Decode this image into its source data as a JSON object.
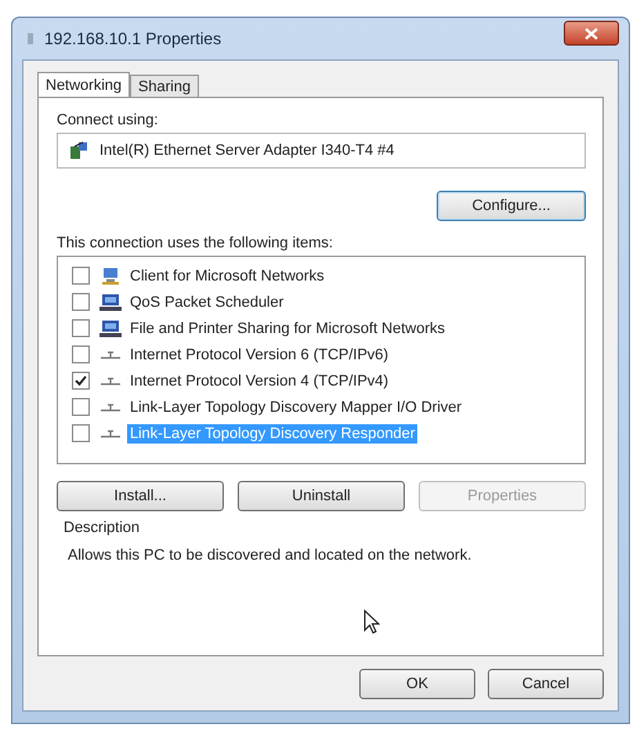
{
  "window": {
    "title": "192.168.10.1 Properties"
  },
  "tabs": [
    {
      "label": "Networking",
      "selected": true
    },
    {
      "label": "Sharing",
      "selected": false
    }
  ],
  "connect_using": {
    "label": "Connect using:",
    "adapter": "Intel(R) Ethernet Server Adapter I340-T4 #4",
    "configure_button": "Configure..."
  },
  "items_label": "This connection uses the following items:",
  "items": [
    {
      "label": "Client for Microsoft Networks",
      "kind": "client",
      "checked": false,
      "selected": false
    },
    {
      "label": "QoS Packet Scheduler",
      "kind": "service",
      "checked": false,
      "selected": false
    },
    {
      "label": "File and Printer Sharing for Microsoft Networks",
      "kind": "service",
      "checked": false,
      "selected": false
    },
    {
      "label": "Internet Protocol Version 6 (TCP/IPv6)",
      "kind": "protocol",
      "checked": false,
      "selected": false
    },
    {
      "label": "Internet Protocol Version 4 (TCP/IPv4)",
      "kind": "protocol",
      "checked": true,
      "selected": false
    },
    {
      "label": "Link-Layer Topology Discovery Mapper I/O Driver",
      "kind": "protocol",
      "checked": false,
      "selected": false
    },
    {
      "label": "Link-Layer Topology Discovery Responder",
      "kind": "protocol",
      "checked": false,
      "selected": true
    }
  ],
  "item_buttons": [
    {
      "label": "Install...",
      "disabled": false
    },
    {
      "label": "Uninstall",
      "disabled": false
    },
    {
      "label": "Properties",
      "disabled": true
    }
  ],
  "description": {
    "label": "Description",
    "text": "Allows this PC to be discovered and located on the network."
  },
  "buttons": [
    {
      "label": "OK"
    },
    {
      "label": "Cancel"
    }
  ]
}
